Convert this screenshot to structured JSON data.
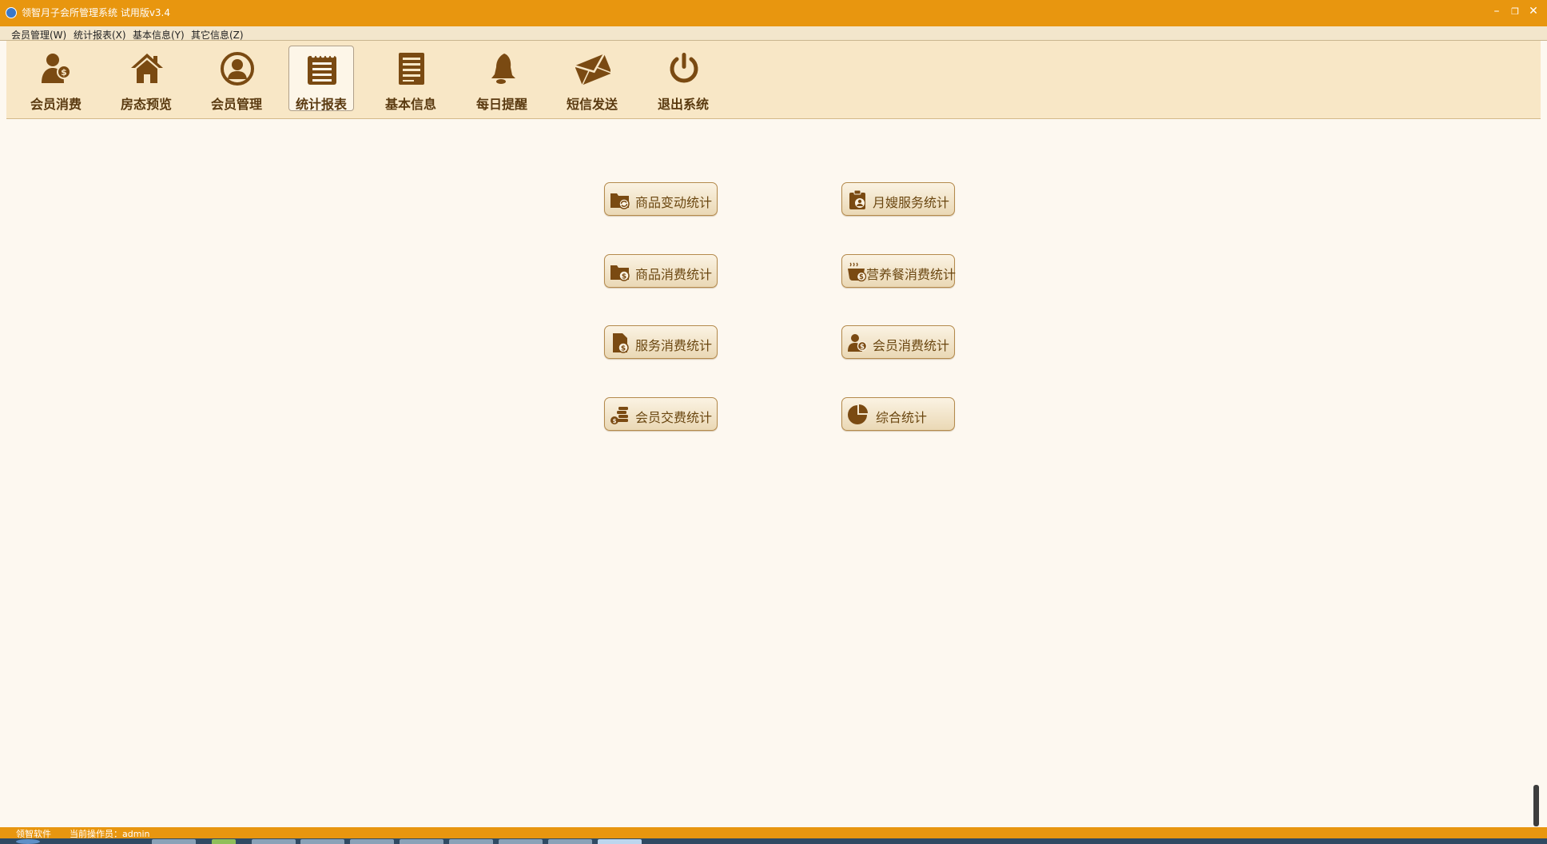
{
  "window": {
    "title": "领智月子会所管理系统 试用版v3.4",
    "controls": {
      "minimize": "–",
      "restore": "❐",
      "close": "✕"
    }
  },
  "menubar": {
    "items": [
      {
        "label": "会员管理(W)"
      },
      {
        "label": "统计报表(X)"
      },
      {
        "label": "基本信息(Y)"
      },
      {
        "label": "其它信息(Z)"
      }
    ]
  },
  "toolbar": {
    "items": [
      {
        "label": "会员消费",
        "icon": "member-money-icon"
      },
      {
        "label": "房态预览",
        "icon": "house-icon"
      },
      {
        "label": "会员管理",
        "icon": "user-circle-icon"
      },
      {
        "label": "统计报表",
        "icon": "report-list-icon",
        "active": true
      },
      {
        "label": "基本信息",
        "icon": "document-icon"
      },
      {
        "label": "每日提醒",
        "icon": "bell-icon"
      },
      {
        "label": "短信发送",
        "icon": "envelope-icon"
      },
      {
        "label": "退出系统",
        "icon": "power-icon"
      }
    ]
  },
  "reports": {
    "items": [
      {
        "label": "商品变动统计",
        "icon": "folder-refresh-icon"
      },
      {
        "label": "月嫂服务统计",
        "icon": "clipboard-user-icon"
      },
      {
        "label": "商品消费统计",
        "icon": "folder-money-icon"
      },
      {
        "label": "营养餐消费统计",
        "icon": "bowl-money-icon"
      },
      {
        "label": "服务消费统计",
        "icon": "file-money-icon"
      },
      {
        "label": "会员消费统计",
        "icon": "member-money-icon"
      },
      {
        "label": "会员交费统计",
        "icon": "coins-icon"
      },
      {
        "label": "综合统计",
        "icon": "pie-icon"
      }
    ]
  },
  "statusbar": {
    "company": "领智软件",
    "operator_label": "当前操作员：admin"
  },
  "colors": {
    "titlebar": "#e8960f",
    "toolbar": "#f8e7c6",
    "icon_brown": "#7a4a12",
    "button_text": "#6b4711"
  }
}
